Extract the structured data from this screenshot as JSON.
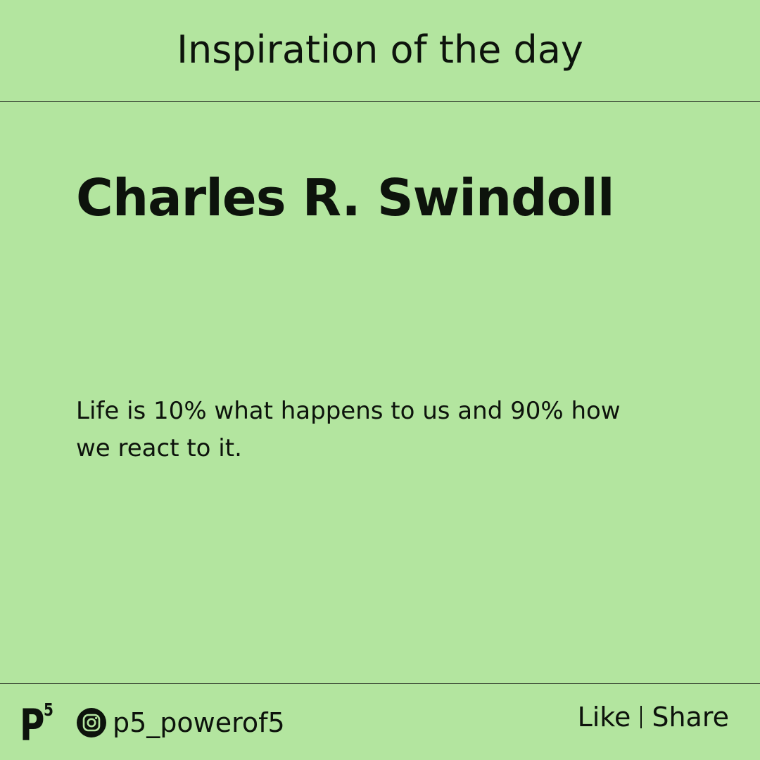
{
  "header": {
    "title": "Inspiration of the day"
  },
  "main": {
    "author": "Charles R. Swindoll",
    "quote": "Life is 10% what happens to us and 90% how we react to it."
  },
  "footer": {
    "logo": {
      "letter": "P",
      "superscript": "5"
    },
    "social_icon": "instagram-icon",
    "handle": "p5_powerof5",
    "like_label": "Like",
    "share_label": "Share"
  },
  "colors": {
    "background": "#b3e59f",
    "text": "#0d130c",
    "divider": "#2f3a2b"
  }
}
